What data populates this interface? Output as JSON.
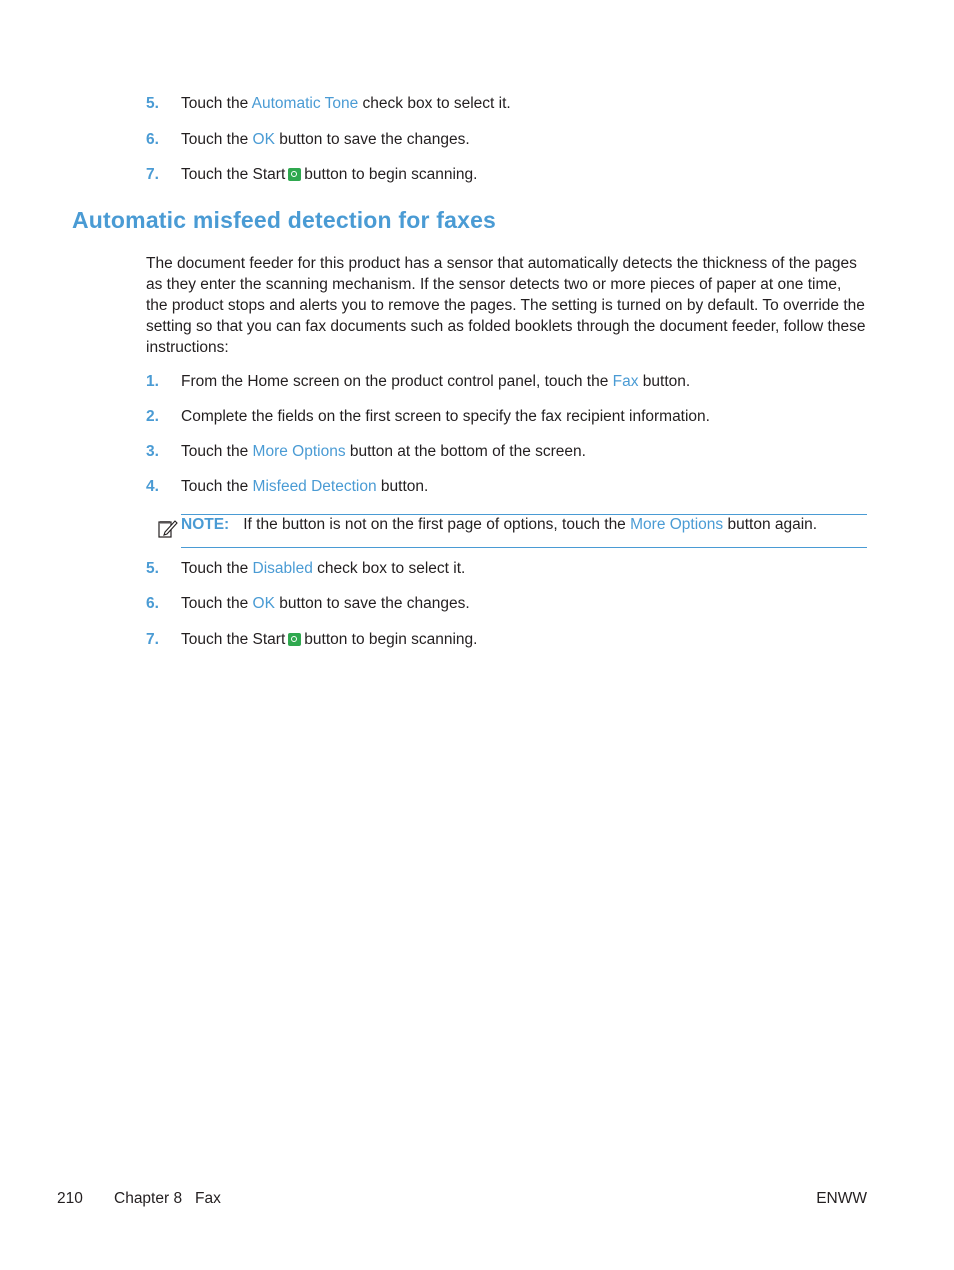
{
  "steps_top": [
    {
      "num": "5.",
      "pre": "Touch the ",
      "link": "Automatic Tone",
      "post": " check box to select it."
    },
    {
      "num": "6.",
      "pre": "Touch the ",
      "link": "OK",
      "post": " button to save the changes."
    },
    {
      "num": "7.",
      "pre": "Touch the Start",
      "post": "button to begin scanning."
    }
  ],
  "section": {
    "title": "Automatic misfeed detection for faxes",
    "intro": "The document feeder for this product has a sensor that automatically detects the thickness of the pages as they enter the scanning mechanism. If the sensor detects two or more pieces of paper at one time, the product stops and alerts you to remove the pages. The setting is turned on by default. To override the setting so that you can fax documents such as folded booklets through the document feeder, follow these instructions:"
  },
  "steps": [
    {
      "num": "1.",
      "pre": "From the Home screen on the product control panel, touch the ",
      "link": "Fax",
      "post": " button."
    },
    {
      "num": "2.",
      "pre": "Complete the fields on the first screen to specify the fax recipient information."
    },
    {
      "num": "3.",
      "pre": "Touch the ",
      "link": "More Options",
      "post": " button at the bottom of the screen."
    },
    {
      "num": "4.",
      "pre": "Touch the ",
      "link": "Misfeed Detection",
      "post": " button."
    },
    {
      "num": "5.",
      "pre": "Touch the ",
      "link": "Disabled",
      "post": " check box to select it."
    },
    {
      "num": "6.",
      "pre": "Touch the ",
      "link": "OK",
      "post": " button to save the changes."
    },
    {
      "num": "7.",
      "pre": "Touch the Start",
      "post": "button to begin scanning."
    }
  ],
  "note": {
    "label": "NOTE:",
    "pre": "If the button is not on the first page of options, touch the ",
    "link": "More Options",
    "post": " button again."
  },
  "footer": {
    "page": "210",
    "chapter": "Chapter 8   Fax",
    "locale": "ENWW"
  }
}
